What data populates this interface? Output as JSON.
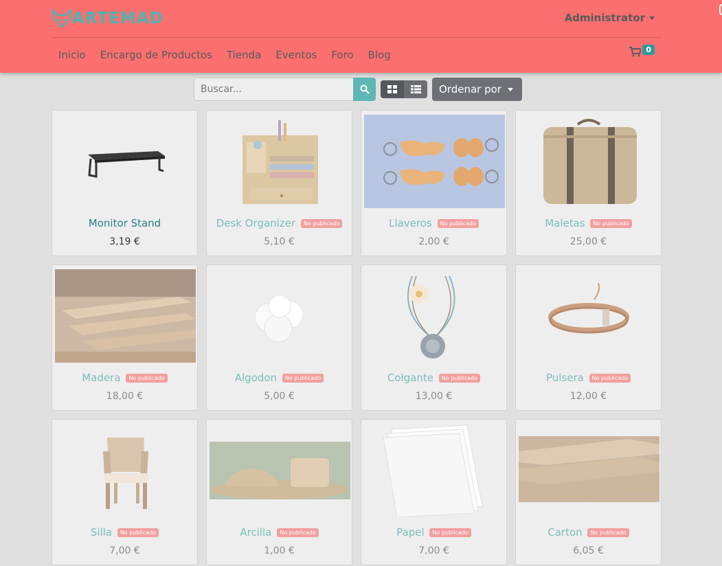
{
  "brand": {
    "name": "ARTEMAD",
    "logo_icon": "fox-head-logo"
  },
  "header": {
    "user_menu": "Administrator"
  },
  "nav": {
    "items": [
      {
        "label": "Inicio"
      },
      {
        "label": "Encargo de Productos"
      },
      {
        "label": "Tienda"
      },
      {
        "label": "Eventos"
      },
      {
        "label": "Foro"
      },
      {
        "label": "Blog"
      }
    ],
    "cart_count": "0"
  },
  "toolbar": {
    "search_placeholder": "Buscar...",
    "sort_label": "Ordenar por"
  },
  "products": [
    {
      "name": "Monitor Stand",
      "price": "3,19 €",
      "badge": "",
      "published": true
    },
    {
      "name": "Desk Organizer",
      "price": "5,10 €",
      "badge": "No publicado",
      "published": false
    },
    {
      "name": "Llaveros",
      "price": "2,00 €",
      "badge": "No publicado",
      "published": false
    },
    {
      "name": "Maletas",
      "price": "25,00 €",
      "badge": "No publicado",
      "published": false
    },
    {
      "name": "Madera",
      "price": "18,00 €",
      "badge": "No publicado",
      "published": false
    },
    {
      "name": "Algodon",
      "price": "5,00 €",
      "badge": "No publicado",
      "published": false
    },
    {
      "name": "Colgante",
      "price": "13,00 €",
      "badge": "No publicado",
      "published": false
    },
    {
      "name": "Pulsera",
      "price": "12,00 €",
      "badge": "No publicado",
      "published": false
    },
    {
      "name": "Silla",
      "price": "7,00 €",
      "badge": "No publicado",
      "published": false
    },
    {
      "name": "Arcilla",
      "price": "1,00 €",
      "badge": "No publicado",
      "published": false
    },
    {
      "name": "Papel",
      "price": "7,00 €",
      "badge": "No publicado",
      "published": false
    },
    {
      "name": "Carton",
      "price": "6,05 €",
      "badge": "No publicado",
      "published": false
    }
  ],
  "colors": {
    "header_bg": "#fb6f6f",
    "accent_teal": "#2f9a9c",
    "badge_unpublished": "#f29f9f"
  }
}
